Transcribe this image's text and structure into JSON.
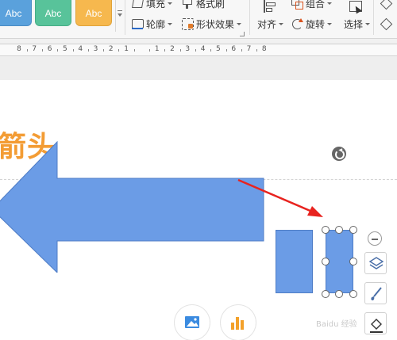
{
  "ribbon": {
    "shape_styles": [
      {
        "label": "Abc",
        "color": "#5aa1dc"
      },
      {
        "label": "Abc",
        "color": "#58c39a"
      },
      {
        "label": "Abc",
        "color": "#f6b84e"
      }
    ],
    "fill_label": "填充",
    "outline_label": "轮廓",
    "format_painter_label": "格式刷",
    "shape_effects_label": "形状效果",
    "align_label": "对齐",
    "group_label": "组合",
    "rotate_label": "旋转",
    "select_label": "选择"
  },
  "ruler": {
    "numbers": [
      "8",
      "7",
      "6",
      "5",
      "4",
      "3",
      "2",
      "1",
      "",
      "1",
      "2",
      "3",
      "4",
      "5",
      "6",
      "7",
      "8"
    ]
  },
  "slide": {
    "title": "箭头",
    "shape_color": "#6b9ce6",
    "accent_color": "#f39c34"
  },
  "watermark": "Baidu 经验",
  "icons": [
    "layers-icon",
    "brush-icon",
    "fill-bucket-icon",
    "image-icon",
    "chart-icon",
    "rotate-handle-icon"
  ]
}
